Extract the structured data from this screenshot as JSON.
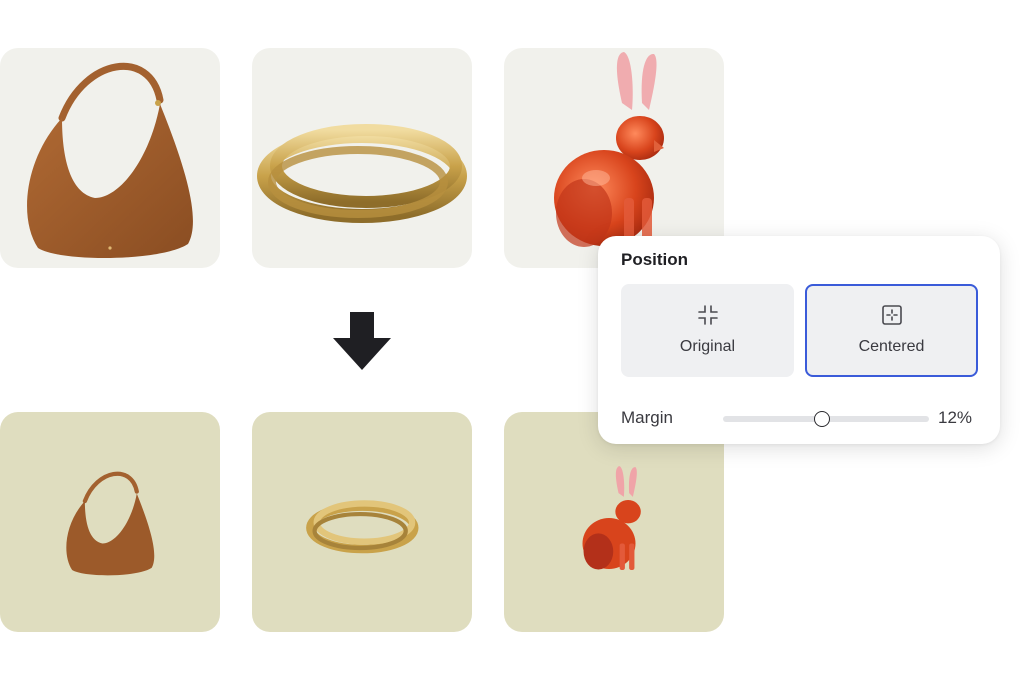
{
  "tiles": {
    "before": [
      "handbag",
      "gold-ring",
      "glass-rabbit"
    ],
    "after": [
      "handbag",
      "gold-ring",
      "glass-rabbit"
    ]
  },
  "colors": {
    "tile_before_bg": "#f1f1ec",
    "tile_after_bg": "#dfddbf",
    "accent": "#3a5bd9",
    "bag": "#9c5a2a",
    "gold": "#c9a24a",
    "rabbit": "#d8441c"
  },
  "panel": {
    "title": "Position",
    "options": [
      {
        "label": "Original",
        "icon": "shrink-corners-icon",
        "selected": false
      },
      {
        "label": "Centered",
        "icon": "center-frame-icon",
        "selected": true
      }
    ],
    "margin": {
      "label": "Margin",
      "value_text": "12%",
      "level": 0.48
    }
  }
}
